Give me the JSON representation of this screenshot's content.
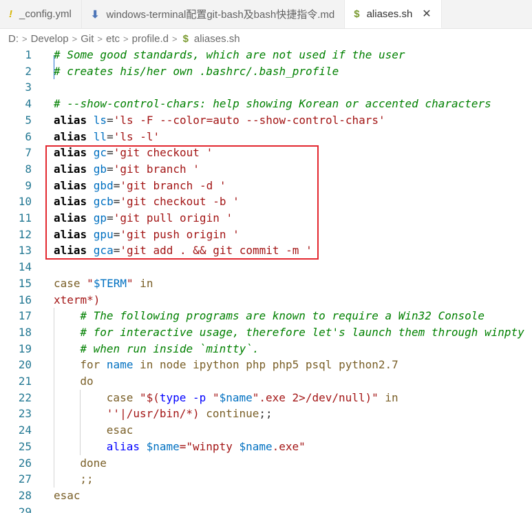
{
  "tabs": [
    {
      "icon": "!",
      "label": "_config.yml",
      "icon_color": "#d7b500"
    },
    {
      "icon": "⬇",
      "label": "windows-terminal配置git-bash及bash快捷指令.md",
      "icon_color": "#4e76b8"
    },
    {
      "icon": "$",
      "label": "aliases.sh",
      "icon_color": "#7a9a30",
      "close": "✕"
    }
  ],
  "breadcrumb": [
    "D:",
    "Develop",
    "Git",
    "etc",
    "profile.d",
    "aliases.sh"
  ],
  "breadcrumb_file_icon": "$",
  "highlight_color": "#e3262e",
  "lines": [
    {
      "n": "1",
      "indent": 0,
      "tokens": [
        {
          "t": "# Some good standards, which are not used if the user",
          "c": "t-comment"
        }
      ]
    },
    {
      "n": "2",
      "indent": 0,
      "tokens": [
        {
          "t": "# creates his/her own .bashrc/.bash_profile",
          "c": "t-comment"
        }
      ]
    },
    {
      "n": "3",
      "indent": 0,
      "tokens": []
    },
    {
      "n": "4",
      "indent": 0,
      "tokens": [
        {
          "t": "# --show-control-chars: help showing Korean or accented characters",
          "c": "t-comment"
        }
      ]
    },
    {
      "n": "5",
      "indent": 0,
      "tokens": [
        {
          "t": "alias ",
          "c": "t-alias"
        },
        {
          "t": "ls",
          "c": "t-var"
        },
        {
          "t": "=",
          "c": "t-plain"
        },
        {
          "t": "'ls -F --color=auto --show-control-chars'",
          "c": "t-str"
        }
      ]
    },
    {
      "n": "6",
      "indent": 0,
      "tokens": [
        {
          "t": "alias ",
          "c": "t-alias"
        },
        {
          "t": "ll",
          "c": "t-var"
        },
        {
          "t": "=",
          "c": "t-plain"
        },
        {
          "t": "'ls -l'",
          "c": "t-str"
        }
      ]
    },
    {
      "n": "7",
      "indent": 0,
      "tokens": [
        {
          "t": "alias ",
          "c": "t-alias"
        },
        {
          "t": "gc",
          "c": "t-var"
        },
        {
          "t": "=",
          "c": "t-plain"
        },
        {
          "t": "'git checkout '",
          "c": "t-str"
        }
      ]
    },
    {
      "n": "8",
      "indent": 0,
      "tokens": [
        {
          "t": "alias ",
          "c": "t-alias"
        },
        {
          "t": "gb",
          "c": "t-var"
        },
        {
          "t": "=",
          "c": "t-plain"
        },
        {
          "t": "'git branch '",
          "c": "t-str"
        }
      ]
    },
    {
      "n": "9",
      "indent": 0,
      "tokens": [
        {
          "t": "alias ",
          "c": "t-alias"
        },
        {
          "t": "gbd",
          "c": "t-var"
        },
        {
          "t": "=",
          "c": "t-plain"
        },
        {
          "t": "'git branch -d '",
          "c": "t-str"
        }
      ]
    },
    {
      "n": "10",
      "indent": 0,
      "tokens": [
        {
          "t": "alias ",
          "c": "t-alias"
        },
        {
          "t": "gcb",
          "c": "t-var"
        },
        {
          "t": "=",
          "c": "t-plain"
        },
        {
          "t": "'git checkout -b '",
          "c": "t-str"
        }
      ]
    },
    {
      "n": "11",
      "indent": 0,
      "tokens": [
        {
          "t": "alias ",
          "c": "t-alias"
        },
        {
          "t": "gp",
          "c": "t-var"
        },
        {
          "t": "=",
          "c": "t-plain"
        },
        {
          "t": "'git pull origin '",
          "c": "t-str"
        }
      ]
    },
    {
      "n": "12",
      "indent": 0,
      "tokens": [
        {
          "t": "alias ",
          "c": "t-alias"
        },
        {
          "t": "gpu",
          "c": "t-var"
        },
        {
          "t": "=",
          "c": "t-plain"
        },
        {
          "t": "'git push origin '",
          "c": "t-str"
        }
      ]
    },
    {
      "n": "13",
      "indent": 0,
      "tokens": [
        {
          "t": "alias ",
          "c": "t-alias"
        },
        {
          "t": "gca",
          "c": "t-var"
        },
        {
          "t": "=",
          "c": "t-plain"
        },
        {
          "t": "'git add . && git commit -m '",
          "c": "t-str"
        }
      ]
    },
    {
      "n": "14",
      "indent": 0,
      "tokens": []
    },
    {
      "n": "15",
      "indent": 0,
      "tokens": [
        {
          "t": "case ",
          "c": "t-case"
        },
        {
          "t": "\"",
          "c": "t-str"
        },
        {
          "t": "$TERM",
          "c": "t-var"
        },
        {
          "t": "\"",
          "c": "t-str"
        },
        {
          "t": " in",
          "c": "t-case"
        }
      ]
    },
    {
      "n": "16",
      "indent": 0,
      "tokens": [
        {
          "t": "xterm*)",
          "c": "t-str"
        }
      ]
    },
    {
      "n": "17",
      "indent": 1,
      "tokens": [
        {
          "t": "# The following programs are known to require a Win32 Console",
          "c": "t-comment"
        }
      ]
    },
    {
      "n": "18",
      "indent": 1,
      "tokens": [
        {
          "t": "# for interactive usage, therefore let's launch them through winpty",
          "c": "t-comment"
        }
      ]
    },
    {
      "n": "19",
      "indent": 1,
      "tokens": [
        {
          "t": "# when run inside `mintty`.",
          "c": "t-comment"
        }
      ]
    },
    {
      "n": "20",
      "indent": 1,
      "tokens": [
        {
          "t": "for ",
          "c": "t-case"
        },
        {
          "t": "name",
          "c": "t-var"
        },
        {
          "t": " in node ipython php php5 psql python2.7",
          "c": "t-case"
        }
      ]
    },
    {
      "n": "21",
      "indent": 1,
      "tokens": [
        {
          "t": "do",
          "c": "t-case"
        }
      ]
    },
    {
      "n": "22",
      "indent": 2,
      "tokens": [
        {
          "t": "case ",
          "c": "t-case"
        },
        {
          "t": "\"$(",
          "c": "t-str"
        },
        {
          "t": "type -p ",
          "c": "t-kw"
        },
        {
          "t": "\"",
          "c": "t-str"
        },
        {
          "t": "$name",
          "c": "t-var"
        },
        {
          "t": "\".exe 2>/dev/null)\"",
          "c": "t-str"
        },
        {
          "t": " in",
          "c": "t-case"
        }
      ]
    },
    {
      "n": "23",
      "indent": 2,
      "tokens": [
        {
          "t": "''|/usr/bin/*)",
          "c": "t-str"
        },
        {
          "t": " continue",
          "c": "t-case"
        },
        {
          "t": ";;",
          "c": "t-plain"
        }
      ]
    },
    {
      "n": "24",
      "indent": 2,
      "tokens": [
        {
          "t": "esac",
          "c": "t-case"
        }
      ]
    },
    {
      "n": "25",
      "indent": 2,
      "tokens": [
        {
          "t": "alias ",
          "c": "t-kw"
        },
        {
          "t": "$name",
          "c": "t-var"
        },
        {
          "t": "=\"winpty ",
          "c": "t-str"
        },
        {
          "t": "$name",
          "c": "t-var"
        },
        {
          "t": ".exe\"",
          "c": "t-str"
        }
      ]
    },
    {
      "n": "26",
      "indent": 1,
      "tokens": [
        {
          "t": "done",
          "c": "t-case"
        }
      ]
    },
    {
      "n": "27",
      "indent": 1,
      "tokens": [
        {
          "t": ";;",
          "c": "t-case"
        }
      ]
    },
    {
      "n": "28",
      "indent": 0,
      "tokens": [
        {
          "t": "esac",
          "c": "t-case"
        }
      ]
    },
    {
      "n": "29",
      "indent": 0,
      "tokens": []
    }
  ]
}
